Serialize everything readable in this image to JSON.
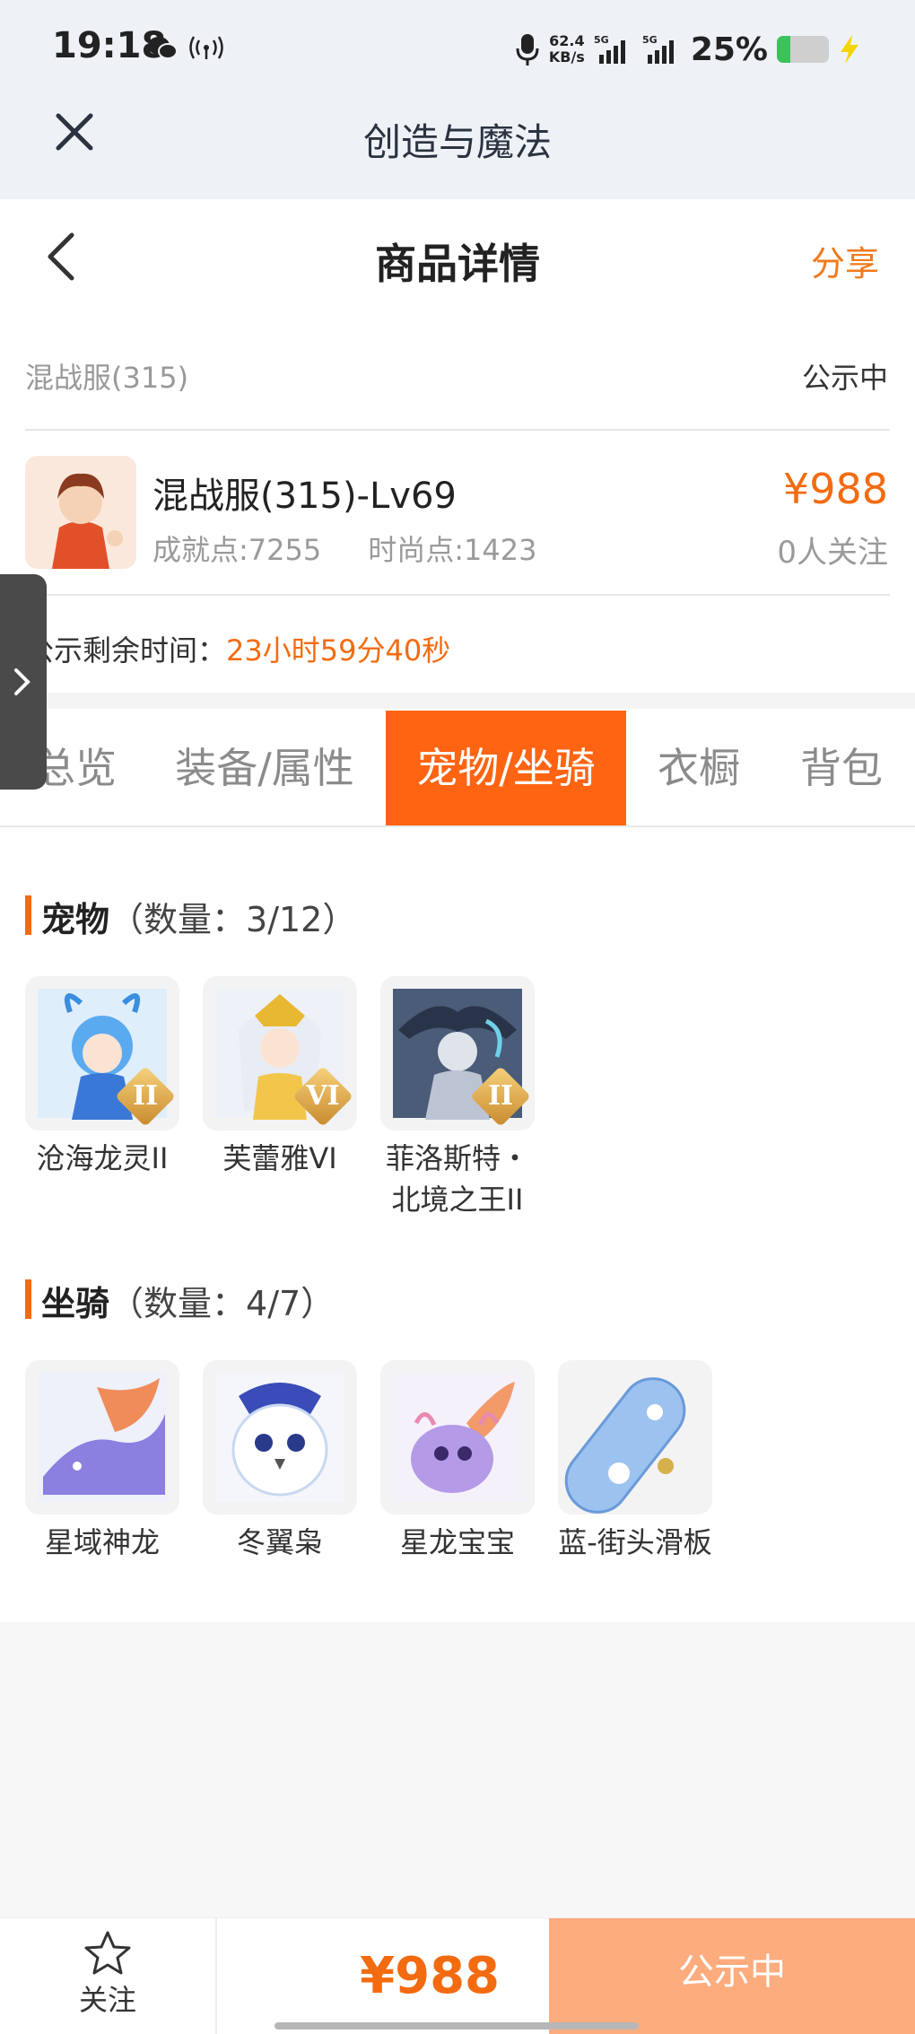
{
  "status_bar": {
    "time": "19:18",
    "net_speed_value": "62.4",
    "net_speed_unit": "KB/s",
    "signal_1_label": "5G",
    "signal_2_label": "5G",
    "battery_percent": "25%",
    "battery_level": 0.25,
    "icons": [
      "wechat-icon",
      "hotspot-icon",
      "microphone-icon",
      "signal-icon",
      "battery-icon",
      "charging-icon"
    ]
  },
  "window": {
    "title": "创造与魔法"
  },
  "nav": {
    "title": "商品详情",
    "share_label": "分享"
  },
  "listing": {
    "server": "混战服(315)",
    "status": "公示中",
    "character_name": "混战服(315)-Lv69",
    "achievement": "成就点:7255",
    "fashion": "时尚点:1423",
    "price": "¥988",
    "followers": "0人关注",
    "remaining_label": "公示剩余时间：",
    "remaining_value": "23小时59分40秒"
  },
  "tabs": [
    {
      "label": "总览",
      "active": false
    },
    {
      "label": "装备/属性",
      "active": false
    },
    {
      "label": "宠物/坐骑",
      "active": true
    },
    {
      "label": "衣橱",
      "active": false
    },
    {
      "label": "背包",
      "active": false
    }
  ],
  "pets": {
    "title": "宠物",
    "count": "（数量：3/12）",
    "items": [
      {
        "name": "沧海龙灵II",
        "badge": "II"
      },
      {
        "name": "芙蕾雅VI",
        "badge": "VI"
      },
      {
        "name": "菲洛斯特・北境之王II",
        "badge": "II"
      }
    ]
  },
  "mounts": {
    "title": "坐骑",
    "count": "（数量：4/7）",
    "items": [
      {
        "name": "星域神龙"
      },
      {
        "name": "冬翼枭"
      },
      {
        "name": "星龙宝宝"
      },
      {
        "name": "蓝-街头滑板"
      }
    ]
  },
  "bottom": {
    "follow_label": "关注",
    "price": "¥988",
    "status": "公示中"
  },
  "colors": {
    "accent": "#ff6412",
    "price": "#f36b10",
    "status_button": "#fdac7e"
  }
}
